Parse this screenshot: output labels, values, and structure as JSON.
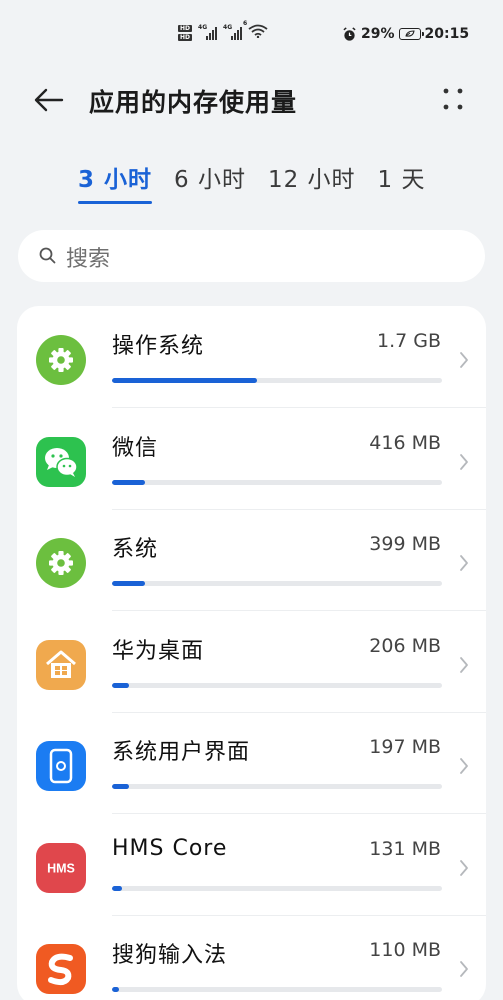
{
  "status_bar": {
    "hd_labels": [
      "HD",
      "HD"
    ],
    "network": [
      "4G",
      "4G",
      "6"
    ],
    "battery": "29%",
    "time": "20:15"
  },
  "header": {
    "title": "应用的内存使用量"
  },
  "tabs": [
    {
      "label": "3 小时",
      "active": true
    },
    {
      "label": "6 小时",
      "active": false
    },
    {
      "label": "12 小时",
      "active": false
    },
    {
      "label": "1 天",
      "active": false
    }
  ],
  "search": {
    "placeholder": "搜索"
  },
  "apps": [
    {
      "name": "操作系统",
      "size": "1.7 GB",
      "usage_fraction": 0.44,
      "icon": "gear-icon",
      "icon_color": "#6cbf3f"
    },
    {
      "name": "微信",
      "size": "416 MB",
      "usage_fraction": 0.1,
      "icon": "wechat-icon",
      "icon_color": "#2dc24f"
    },
    {
      "name": "系统",
      "size": "399 MB",
      "usage_fraction": 0.1,
      "icon": "gear-icon",
      "icon_color": "#6cbf3f"
    },
    {
      "name": "华为桌面",
      "size": "206 MB",
      "usage_fraction": 0.05,
      "icon": "home-icon",
      "icon_color": "#f0a94e"
    },
    {
      "name": "系统用户界面",
      "size": "197 MB",
      "usage_fraction": 0.05,
      "icon": "system-ui-icon",
      "icon_color": "#1b7cf2"
    },
    {
      "name": "HMS Core",
      "size": "131 MB",
      "usage_fraction": 0.03,
      "icon": "hms-icon",
      "icon_color": "#e0474c",
      "icon_text": "HMS"
    },
    {
      "name": "搜狗输入法",
      "size": "110 MB",
      "usage_fraction": 0.02,
      "icon": "sogou-icon",
      "icon_color": "#f05a22"
    }
  ],
  "colors": {
    "accent": "#1a62d6",
    "background": "#f1f3f5"
  }
}
